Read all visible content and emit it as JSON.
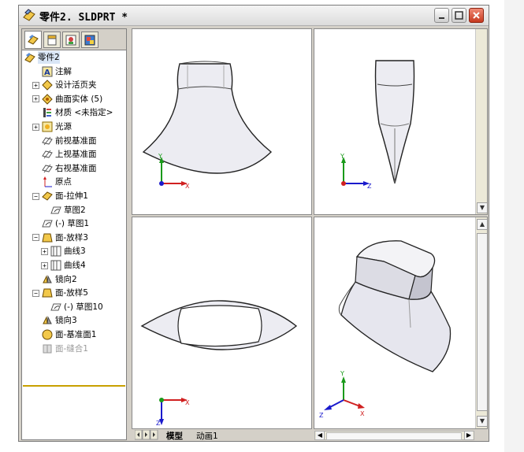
{
  "window": {
    "title": "零件2. SLDPRT *"
  },
  "feature_tree": {
    "tabs": [
      "feature-manager",
      "property-manager",
      "configuration-manager",
      "display-manager"
    ],
    "items": [
      {
        "label": "零件2",
        "icon": "part-icon",
        "expander": "",
        "indent": 0
      },
      {
        "label": "注解",
        "icon": "annotation-icon",
        "expander": "",
        "indent": 1
      },
      {
        "label": "设计活页夹",
        "icon": "design-binder-icon",
        "expander": "+",
        "indent": 1
      },
      {
        "label": "曲面实体 (5)",
        "icon": "surface-bodies-icon",
        "expander": "+",
        "indent": 1
      },
      {
        "label": "材质 <未指定>",
        "icon": "material-icon",
        "expander": "",
        "indent": 1
      },
      {
        "label": "光源",
        "icon": "lights-icon",
        "expander": "+",
        "indent": 1
      },
      {
        "label": "前视基准面",
        "icon": "plane-icon",
        "expander": "",
        "indent": 1
      },
      {
        "label": "上视基准面",
        "icon": "plane-icon",
        "expander": "",
        "indent": 1
      },
      {
        "label": "右视基准面",
        "icon": "plane-icon",
        "expander": "",
        "indent": 1
      },
      {
        "label": "原点",
        "icon": "origin-icon",
        "expander": "",
        "indent": 1
      },
      {
        "label": "面-拉伸1",
        "icon": "surface-extrude-icon",
        "expander": "−",
        "indent": 1
      },
      {
        "label": "草图2",
        "icon": "sketch-icon",
        "expander": "",
        "indent": 2
      },
      {
        "label": "(-) 草图1",
        "icon": "sketch-icon",
        "expander": "",
        "indent": 1
      },
      {
        "label": "面-放样3",
        "icon": "surface-loft-icon",
        "expander": "−",
        "indent": 1
      },
      {
        "label": "曲线3",
        "icon": "curve-icon",
        "expander": "+",
        "indent": 2
      },
      {
        "label": "曲线4",
        "icon": "curve-icon",
        "expander": "+",
        "indent": 2
      },
      {
        "label": "镜向2",
        "icon": "mirror-icon",
        "expander": "",
        "indent": 1
      },
      {
        "label": "面-放样5",
        "icon": "surface-loft-icon",
        "expander": "−",
        "indent": 1
      },
      {
        "label": "(-) 草图10",
        "icon": "sketch-icon",
        "expander": "",
        "indent": 2
      },
      {
        "label": "镜向3",
        "icon": "mirror-icon",
        "expander": "",
        "indent": 1
      },
      {
        "label": "面-基准面1",
        "icon": "planar-surface-icon",
        "expander": "",
        "indent": 1
      },
      {
        "label": "面-缝合1",
        "icon": "knit-icon",
        "expander": "",
        "indent": 1,
        "dim": true
      }
    ]
  },
  "viewports": {
    "axis_labels": {
      "x": "X",
      "y": "Y",
      "z": "Z"
    },
    "colors": {
      "x_axis": "#d02020",
      "y_axis": "#1a9a1a",
      "z_axis": "#1a1acc",
      "model_fill": "#e8e8ef",
      "model_edge": "#222222"
    }
  },
  "bottom_tabs": {
    "model": "模型",
    "motion": "动画1"
  }
}
